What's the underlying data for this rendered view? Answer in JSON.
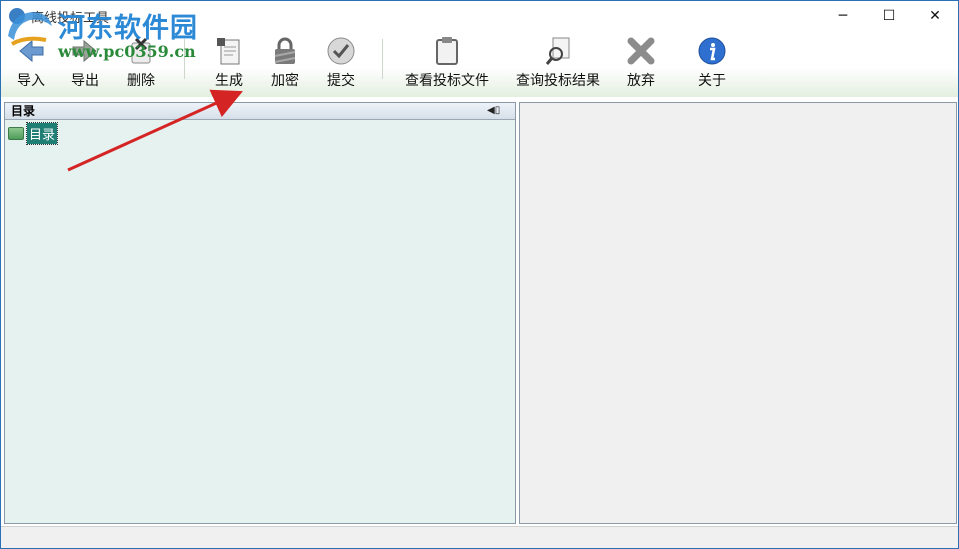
{
  "window": {
    "title": "离线投标工具",
    "minimize_glyph": "─",
    "maximize_glyph": "☐",
    "close_glyph": "✕"
  },
  "watermark": {
    "name": "河东软件园",
    "url": "www.pc0359.cn"
  },
  "toolbar": {
    "items": [
      {
        "label": "导入",
        "icon": "import-icon"
      },
      {
        "label": "导出",
        "icon": "export-icon"
      },
      {
        "label": "删除",
        "icon": "delete-icon"
      },
      {
        "label": "生成",
        "icon": "generate-icon"
      },
      {
        "label": "加密",
        "icon": "lock-icon"
      },
      {
        "label": "提交",
        "icon": "submit-check-icon"
      },
      {
        "label": "查看投标文件",
        "icon": "clipboard-icon"
      },
      {
        "label": "查询投标结果",
        "icon": "search-document-icon"
      },
      {
        "label": "放弃",
        "icon": "abandon-x-icon"
      },
      {
        "label": "关于",
        "icon": "info-icon"
      }
    ]
  },
  "left_panel": {
    "title": "目录",
    "pin_glyph": "◀▯",
    "tree": [
      {
        "label": "目录",
        "icon": "folder-icon",
        "selected": true
      }
    ]
  },
  "colors": {
    "accent": "#2c89d6",
    "tree_selection": "#1f7f74",
    "annotation_arrow": "#d42424"
  }
}
